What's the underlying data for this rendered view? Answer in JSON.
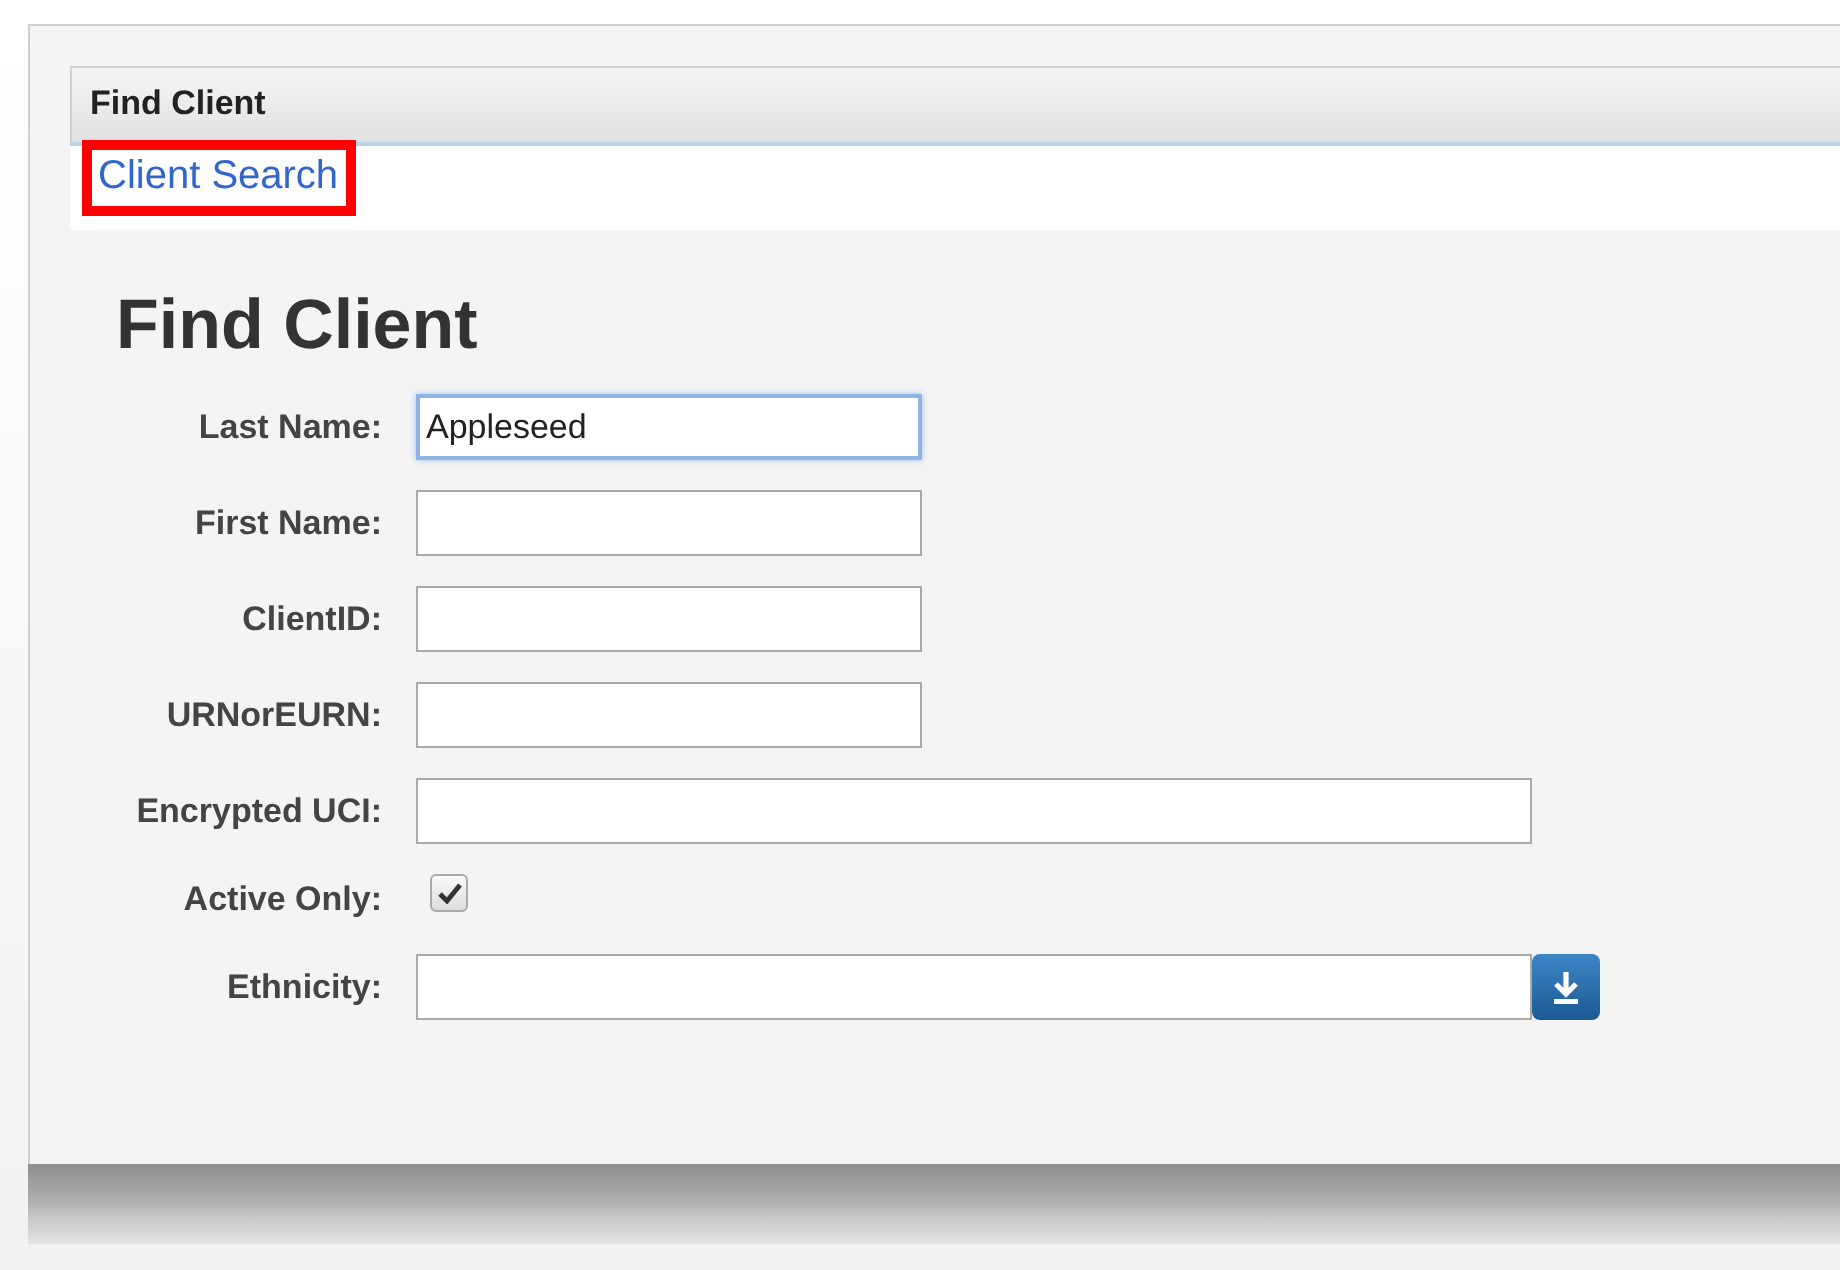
{
  "panel": {
    "title": "Find Client"
  },
  "breadcrumb": {
    "label": "Client Search",
    "highlighted": true
  },
  "heading": "Find Client",
  "fields": [
    {
      "kind": "text",
      "label": "Last Name:",
      "value": "Appleseed",
      "focused": true,
      "wide": false
    },
    {
      "kind": "text",
      "label": "First Name:",
      "focused": false,
      "wide": false
    },
    {
      "kind": "text",
      "label": "ClientID:",
      "focused": false,
      "wide": false
    },
    {
      "kind": "text",
      "label": "URNorEURN:",
      "focused": false,
      "wide": false
    },
    {
      "kind": "text",
      "label": "Encrypted UCI:",
      "focused": false,
      "wide": true
    },
    {
      "kind": "checkbox",
      "label": "Active Only:",
      "checked": true
    },
    {
      "kind": "select",
      "label": "Ethnicity:",
      "focused": false,
      "wide": true
    }
  ]
}
